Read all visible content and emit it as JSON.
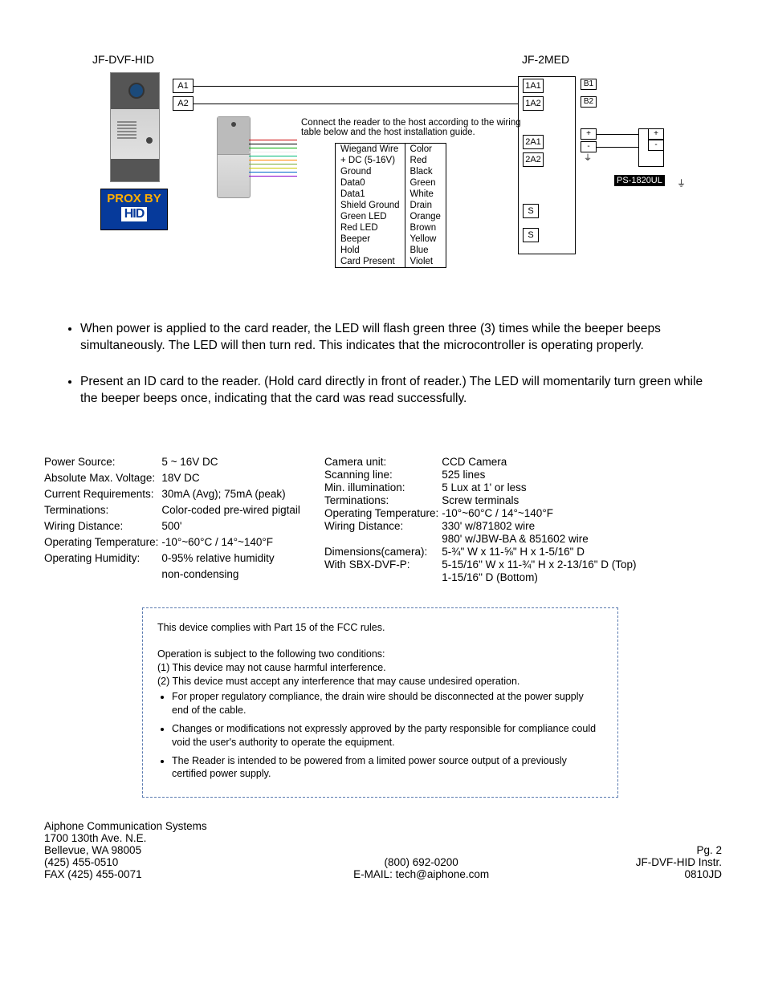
{
  "diagram": {
    "left_label": "JF-DVF-HID",
    "right_label": "JF-2MED",
    "prox_line1": "PROX BY",
    "prox_line2": "HID",
    "pins_left": [
      "A1",
      "A2"
    ],
    "pins_right": [
      "1A1",
      "1A2",
      "2A1",
      "2A2",
      "S",
      "S"
    ],
    "pins_right_extra": [
      "B1",
      "B2",
      "+",
      "-"
    ],
    "psu_left": [
      "+",
      "-"
    ],
    "psu_label": "PS-1820UL",
    "connect_text": "Connect the reader to the host according to the wiring table below and the host installation guide.",
    "wiegand_header": [
      "Wiegand  Wire",
      "Color"
    ],
    "wiegand_rows": [
      [
        "+ DC (5-16V)",
        "Red"
      ],
      [
        "Ground",
        "Black"
      ],
      [
        "Data0",
        "Green"
      ],
      [
        "Data1",
        "White"
      ],
      [
        "Shield Ground",
        "Drain"
      ],
      [
        "Green LED",
        "Orange"
      ],
      [
        "Red LED",
        "Brown"
      ],
      [
        "Beeper",
        "Yellow"
      ],
      [
        "Hold",
        "Blue"
      ],
      [
        "Card Present",
        "Violet"
      ]
    ],
    "wire_colors": [
      "#c00",
      "#000",
      "#0a0",
      "#34a",
      "#0b7",
      "#f80",
      "#7a3",
      "#cc0",
      "#06c",
      "#80c"
    ]
  },
  "bullets": [
    "When power is applied to the card reader, the LED will flash green three (3) times while the beeper beeps simultaneously. The LED will then turn red. This indicates that the microcontroller is operating properly.",
    "Present an ID card to the reader. (Hold card directly in front of reader.) The LED will momentarily turn green while the beeper beeps once, indicating that the card was read successfully."
  ],
  "specs_left": [
    [
      "Power Source:",
      "5 ~ 16V DC"
    ],
    [
      "Absolute Max. Voltage:",
      "18V DC"
    ],
    [
      "Current Requirements:",
      "30mA (Avg); 75mA (peak)"
    ],
    [
      "Terminations:",
      "Color-coded pre-wired pigtail"
    ],
    [
      "Wiring Distance:",
      "500'"
    ],
    [
      "Operating Temperature:",
      "-10°~60°C / 14°~140°F"
    ],
    [
      "Operating Humidity:",
      "0-95% relative humidity"
    ],
    [
      "",
      "non-condensing"
    ]
  ],
  "specs_right": [
    [
      "Camera unit:",
      "CCD Camera"
    ],
    [
      "Scanning line:",
      "525 lines"
    ],
    [
      "Min. illumination:",
      "5 Lux at 1' or less"
    ],
    [
      "Terminations:",
      "Screw terminals"
    ],
    [
      "Operating Temperature:",
      "-10°~60°C  /  14°~140°F"
    ],
    [
      "Wiring Distance:",
      "330' w/871802 wire"
    ],
    [
      "",
      "980' w/JBW-BA & 851602 wire"
    ],
    [
      "Dimensions(camera):",
      "5-¾\" W x 11-⅝\" H x 1-5/16\" D"
    ],
    [
      "With SBX-DVF-P:",
      "5-15/16\" W x 11-¾\" H x 2-13/16\" D (Top)"
    ],
    [
      "",
      "1-15/16\" D (Bottom)"
    ]
  ],
  "fcc": {
    "line1": "This device complies with Part 15 of the FCC rules.",
    "line2": "Operation is subject to the following two conditions:",
    "cond1": "(1) This device may not cause harmful interference.",
    "cond2": "(2) This device must accept any interference that may cause undesired operation.",
    "bullets": [
      "For proper regulatory compliance, the drain wire should be disconnected at the power supply end of the cable.",
      "Changes or modifications not expressly approved by the party responsible for compliance could void the user's authority to operate the equipment.",
      "The Reader is intended to be powered from a limited power source output of a previously certified power supply."
    ]
  },
  "footer": {
    "company": "Aiphone Communication Systems",
    "addr1": "1700 130th Ave. N.E.",
    "addr2": "Bellevue, WA  98005",
    "phone": "(425) 455-0510",
    "fax": "FAX (425) 455-0071",
    "tollfree": "(800) 692-0200",
    "email": "E-MAIL: tech@aiphone.com",
    "page": "Pg. 2",
    "model": "JF-DVF-HID Instr.",
    "rev": "0810JD"
  }
}
